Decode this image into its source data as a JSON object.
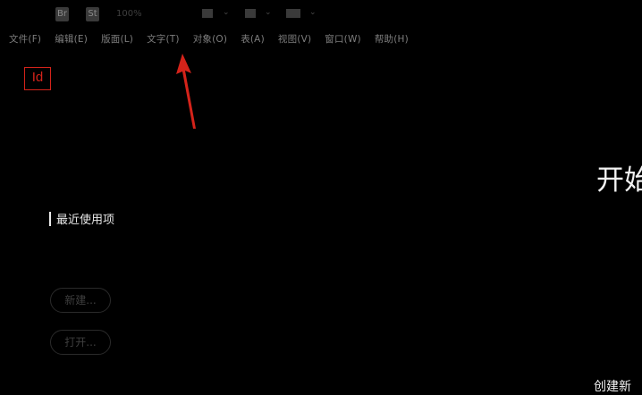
{
  "toolbar": {
    "br_label": "Br",
    "st_label": "St",
    "zoom_value": "100%"
  },
  "menu": [
    {
      "label": "文件(F)"
    },
    {
      "label": "编辑(E)"
    },
    {
      "label": "版面(L)"
    },
    {
      "label": "文字(T)"
    },
    {
      "label": "对象(O)"
    },
    {
      "label": "表(A)"
    },
    {
      "label": "视图(V)"
    },
    {
      "label": "窗口(W)"
    },
    {
      "label": "帮助(H)"
    }
  ],
  "app": {
    "logo_text": "Id"
  },
  "sidebar": {
    "recent_label": "最近使用项",
    "new_button": "新建...",
    "open_button": "打开..."
  },
  "main": {
    "hero_title_partial": "开始",
    "bottom_partial_text": "创建新"
  },
  "colors": {
    "background": "#000000",
    "logo_red": "#d4231a",
    "arrow_red": "#d4231a"
  }
}
